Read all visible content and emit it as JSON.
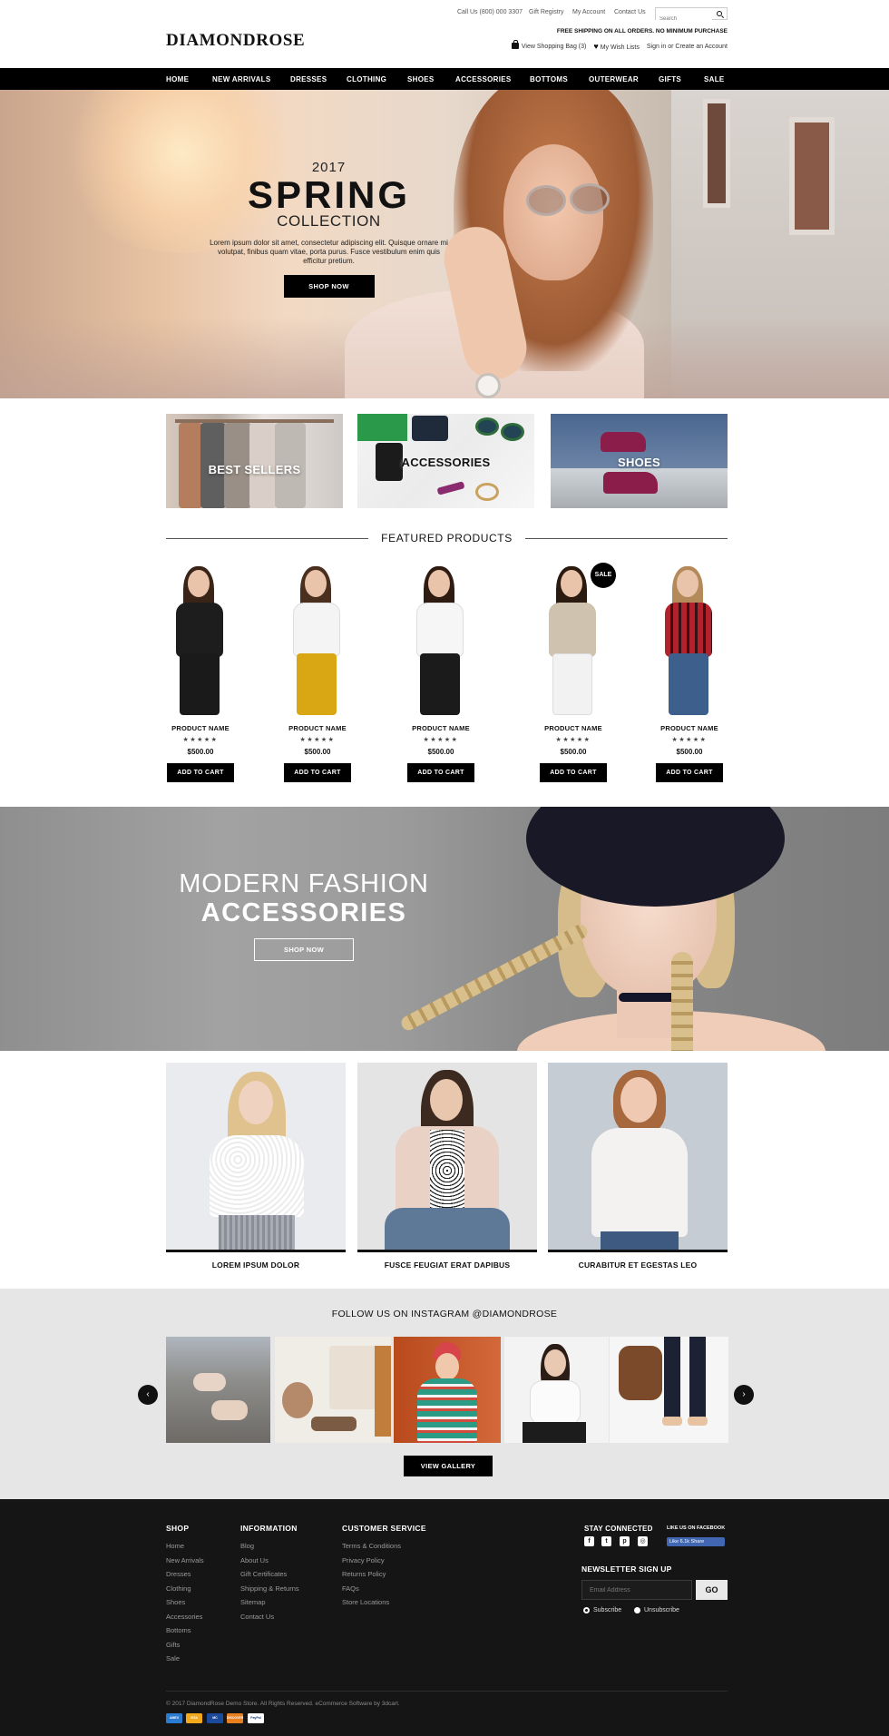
{
  "header": {
    "links": [
      "Call Us (800) 000 3307",
      "Gift Registry",
      "My Account",
      "Contact Us"
    ],
    "search_placeholder": "Search",
    "logo": "DIAMONDROSE",
    "free_shipping": "FREE SHIPPING ON ALL ORDERS.  NO MINIMUM PURCHASE",
    "bag": "View Shopping Bag (3)",
    "wishlist": "My Wish Lists",
    "account": "Sign in or Create an Account"
  },
  "nav": [
    "HOME",
    "NEW ARRIVALS",
    "DRESSES",
    "CLOTHING",
    "SHOES",
    "ACCESSORIES",
    "BOTTOMS",
    "OUTERWEAR",
    "GIFTS",
    "SALE"
  ],
  "hero": {
    "year": "2017",
    "title": "SPRING",
    "subtitle": "COLLECTION",
    "body": "Lorem ipsum dolor sit amet, consectetur adipiscing elit. Quisque ornare mi volutpat, finibus quam vitae, porta purus. Fusce vestibulum enim quis efficitur pretium.",
    "button": "SHOP NOW"
  },
  "categories": [
    "BEST SELLERS",
    "ACCESSORIES",
    "SHOES"
  ],
  "featured": {
    "title": "FEATURED PRODUCTS",
    "products": [
      {
        "name": "PRODUCT NAME",
        "stars": "★★★★★",
        "price": "$500.00",
        "button": "ADD TO CART"
      },
      {
        "name": "PRODUCT NAME",
        "stars": "★★★★★",
        "price": "$500.00",
        "button": "ADD TO CART"
      },
      {
        "name": "PRODUCT NAME",
        "stars": "★★★★★",
        "price": "$500.00",
        "button": "ADD TO CART"
      },
      {
        "name": "PRODUCT NAME",
        "stars": "★★★★★",
        "price": "$500.00",
        "button": "ADD TO CART",
        "badge": "SALE"
      },
      {
        "name": "PRODUCT NAME",
        "stars": "★★★★★",
        "price": "$500.00",
        "button": "ADD TO CART"
      }
    ]
  },
  "banner2": {
    "line1": "MODERN FASHION",
    "line2": "ACCESSORIES",
    "button": "SHOP NOW"
  },
  "lookbook": [
    "LOREM IPSUM DOLOR",
    "FUSCE FEUGIAT ERAT DAPIBUS",
    "CURABITUR ET EGESTAS LEO"
  ],
  "instagram": {
    "title": "FOLLOW US ON INSTAGRAM @DIAMONDROSE",
    "prev": "‹",
    "next": "›",
    "button": "VIEW GALLERY"
  },
  "footer": {
    "shop": {
      "title": "SHOP",
      "links": [
        "Home",
        "New Arrivals",
        "Dresses",
        "Clothing",
        "Shoes",
        "Accessories",
        "Bottoms",
        "Gifts",
        "Sale"
      ]
    },
    "info": {
      "title": "INFORMATION",
      "links": [
        "Blog",
        "About Us",
        "Gift Certificates",
        "Shipping & Returns",
        "Sitemap",
        "Contact Us"
      ]
    },
    "service": {
      "title": "CUSTOMER SERVICE",
      "links": [
        "Terms & Conditions",
        "Privacy Policy",
        "Returns Policy",
        "FAQs",
        "Store Locations"
      ]
    },
    "stay_connected": "STAY CONNECTED",
    "like_fb": "LIKE US ON FACEBOOK",
    "fb_button": "Like 6.1k  Share",
    "newsletter": "NEWSLETTER SIGN UP",
    "email_placeholder": "Email Address",
    "go": "GO",
    "subscribe": "Subscribe",
    "unsubscribe": "Unsubscribe",
    "copyright": "© 2017 DiamondRose Demo Store. All Rights Reserved. eCommerce Software by 3dcart.",
    "payments": [
      "AMEX",
      "VISA",
      "MC",
      "DISCOVER",
      "PayPal"
    ]
  }
}
